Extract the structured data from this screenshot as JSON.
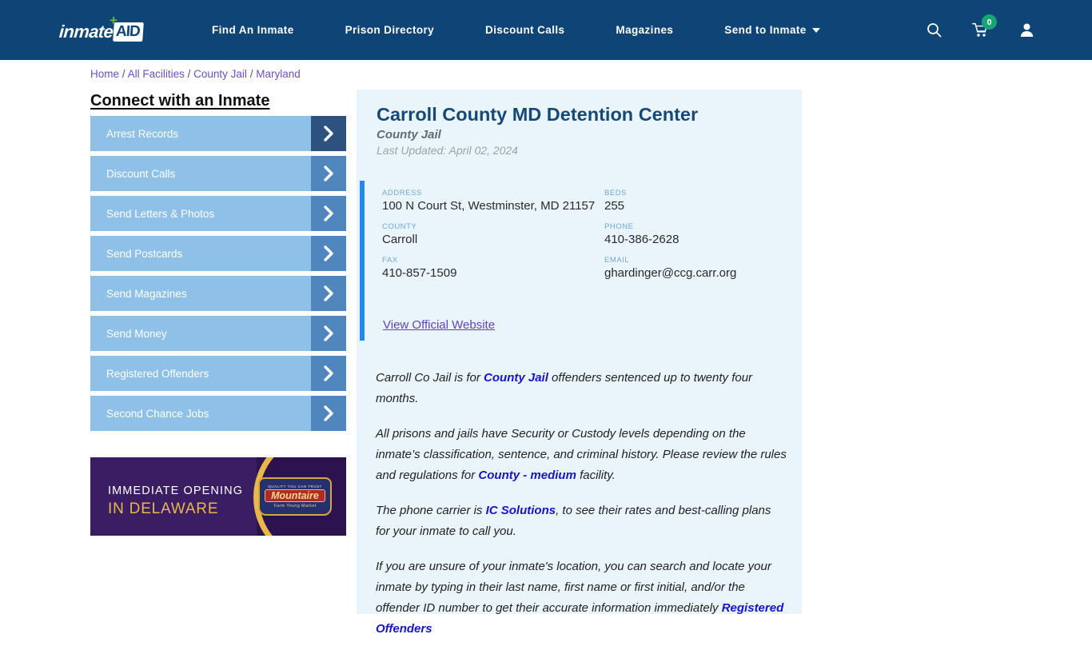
{
  "header": {
    "logo": {
      "word": "inmate",
      "badge": "AID",
      "plus_icon": "plus-icon"
    },
    "nav": [
      {
        "label": "Find An Inmate"
      },
      {
        "label": "Prison Directory"
      },
      {
        "label": "Discount Calls"
      },
      {
        "label": "Magazines"
      },
      {
        "label": "Send to Inmate",
        "dropdown": true
      }
    ],
    "icons": {
      "search": "search-icon",
      "cart": "cart-icon",
      "cart_count": "0",
      "account": "user-icon"
    },
    "bg_color": "#0f4576",
    "badge_color": "#17a673"
  },
  "breadcrumb": {
    "items": [
      "Home",
      "All Facilities",
      "County Jail",
      "Maryland"
    ],
    "separator": "/"
  },
  "sidebar": {
    "title": "Connect with an Inmate",
    "items": [
      {
        "label": "Arrest Records",
        "active": true
      },
      {
        "label": "Discount Calls",
        "active": false
      },
      {
        "label": "Send Letters & Photos",
        "active": false
      },
      {
        "label": "Send Postcards",
        "active": false
      },
      {
        "label": "Send Magazines",
        "active": false
      },
      {
        "label": "Send Money",
        "active": false
      },
      {
        "label": "Registered Offenders",
        "active": false
      },
      {
        "label": "Second Chance Jobs",
        "active": false
      }
    ]
  },
  "ad": {
    "line1": "IMMEDIATE OPENING",
    "line2": "IN DELAWARE",
    "logo_top": "QUALITY YOU CAN TRUST",
    "logo_main": "Mountaire",
    "logo_sub": "Farm Young Market"
  },
  "facility": {
    "name": "Carroll County MD Detention Center",
    "type": "County Jail",
    "last_updated": "Last Updated: April 02, 2024",
    "accent_color": "#1f8aeb",
    "fields": [
      {
        "label": "ADDRESS",
        "value": "100 N Court St, Westminster, MD 21157"
      },
      {
        "label": "BEDS",
        "value": "255"
      },
      {
        "label": "COUNTY",
        "value": "Carroll"
      },
      {
        "label": "PHONE",
        "value": "410-386-2628"
      },
      {
        "label": "FAX",
        "value": "410-857-1509"
      },
      {
        "label": "EMAIL",
        "value": "ghardinger@ccg.carr.org"
      }
    ],
    "website_link": "View Official Website"
  },
  "body": {
    "p1_a": "Carroll Co Jail is for ",
    "p1_link": "County Jail",
    "p1_b": " offenders sentenced up to twenty four months.",
    "p2_a": "All prisons and jails have Security or Custody levels depending on the inmate’s classification, sentence, and criminal history. Please review the rules and regulations for ",
    "p2_link": "County - medium",
    "p2_b": " facility.",
    "p3_a": "The phone carrier is ",
    "p3_link": "IC Solutions",
    "p3_b": ", to see their rates and best-calling plans for your inmate to call you.",
    "p4_a": "If you are unsure of your inmate's location, you can search and locate your inmate by typing in their last name, first name or first initial, and/or the offender ID number to get their accurate information immediately ",
    "p4_link": "Registered Offenders"
  }
}
